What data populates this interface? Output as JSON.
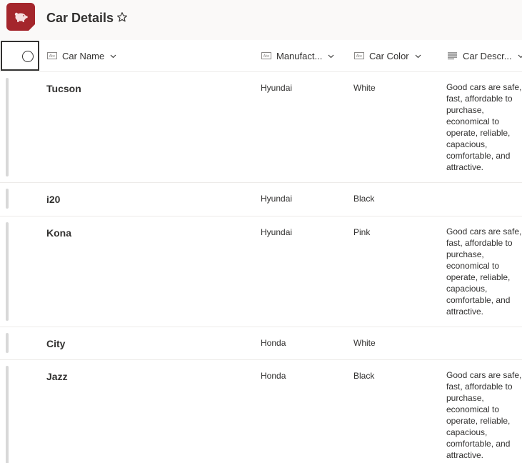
{
  "app": {
    "icon": "piggy-bank-icon",
    "brand_color": "#a4262c",
    "title": "Car Details"
  },
  "columns": [
    {
      "key": "name",
      "label": "Car Name",
      "type_icon": "text-field-icon"
    },
    {
      "key": "manufacturer",
      "label": "Manufact...",
      "type_icon": "text-field-icon"
    },
    {
      "key": "color",
      "label": "Car Color",
      "type_icon": "text-field-icon"
    },
    {
      "key": "description",
      "label": "Car Descr...",
      "type_icon": "multiline-text-icon"
    }
  ],
  "rows": [
    {
      "name": "Tucson",
      "manufacturer": "Hyundai",
      "color": "White",
      "description": [
        "Good cars are safe,",
        "fast, affordable to",
        "purchase,",
        "economical to",
        "operate, reliable,",
        "capacious,",
        "comfortable, and",
        "attractive."
      ]
    },
    {
      "name": "i20",
      "manufacturer": "Hyundai",
      "color": "Black",
      "description": []
    },
    {
      "name": "Kona",
      "manufacturer": "Hyundai",
      "color": "Pink",
      "description": [
        "Good cars are safe,",
        "fast, affordable to",
        "purchase,",
        "economical to",
        "operate, reliable,",
        "capacious,",
        "comfortable, and",
        "attractive."
      ]
    },
    {
      "name": "City",
      "manufacturer": "Honda",
      "color": "White",
      "description": []
    },
    {
      "name": "Jazz",
      "manufacturer": "Honda",
      "color": "Black",
      "description": [
        "Good cars are safe,",
        "fast, affordable to",
        "purchase,",
        "economical to",
        "operate, reliable,",
        "capacious,",
        "comfortable, and",
        "attractive."
      ]
    }
  ]
}
